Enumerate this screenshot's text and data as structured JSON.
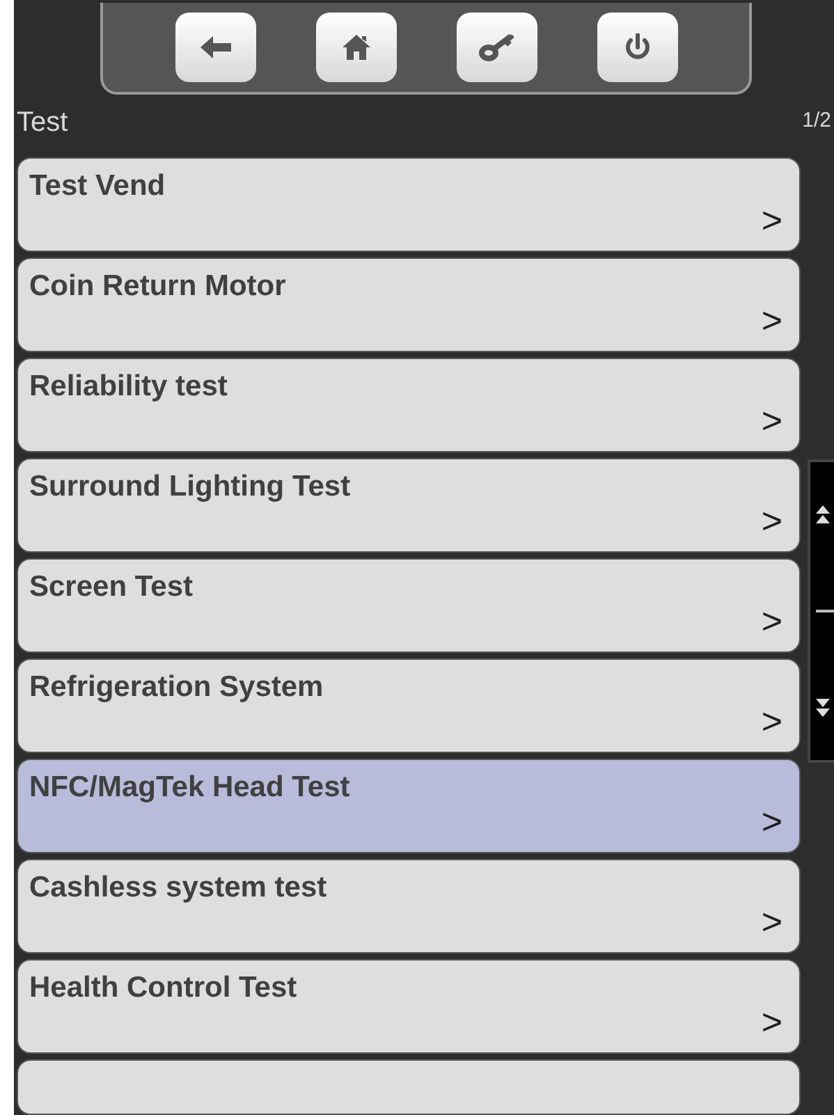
{
  "toolbar": {
    "buttons": [
      {
        "kind": "back"
      },
      {
        "kind": "home"
      },
      {
        "kind": "key"
      },
      {
        "kind": "power"
      }
    ]
  },
  "header": {
    "title": "Test",
    "page": "1/2"
  },
  "menu": [
    {
      "label": "Test Vend",
      "chevron": ">",
      "selected": false
    },
    {
      "label": "Coin Return Motor",
      "chevron": ">",
      "selected": false
    },
    {
      "label": "Reliability test",
      "chevron": ">",
      "selected": false
    },
    {
      "label": "Surround Lighting Test",
      "chevron": ">",
      "selected": false
    },
    {
      "label": "Screen Test",
      "chevron": ">",
      "selected": false
    },
    {
      "label": "Refrigeration System",
      "chevron": ">",
      "selected": false
    },
    {
      "label": "NFC/MagTek Head Test",
      "chevron": ">",
      "selected": true
    },
    {
      "label": "Cashless system test",
      "chevron": ">",
      "selected": false
    },
    {
      "label": "Health Control Test",
      "chevron": ">",
      "selected": false
    }
  ]
}
